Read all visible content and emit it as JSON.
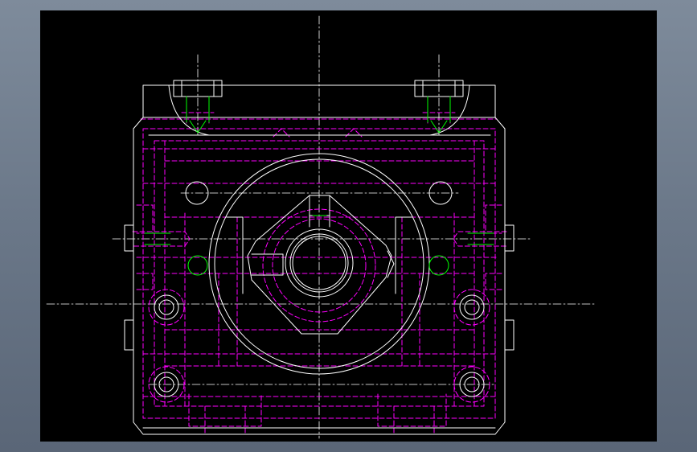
{
  "window": {
    "background_gradient": [
      "#7e8b9b",
      "#5a6677"
    ],
    "viewport_background": "#000000"
  },
  "drawing": {
    "colors": {
      "visible_edge": "#ffffff",
      "hidden_edge": "#ff00ff",
      "thread": "#00ff00",
      "centerline": "#ffffff"
    },
    "layers": [
      "visible-edges",
      "hidden-edges",
      "threads",
      "centerlines"
    ]
  }
}
